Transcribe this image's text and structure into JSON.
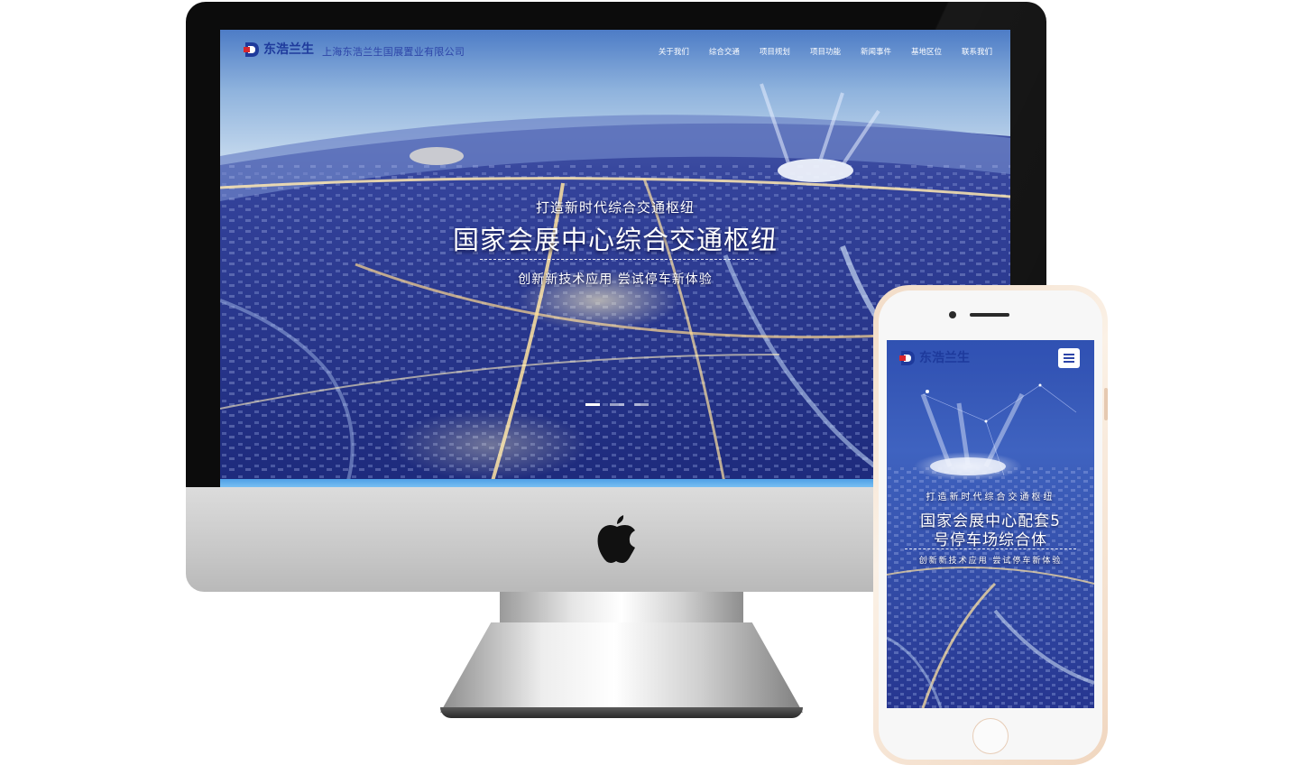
{
  "desktop": {
    "brand_name": "东浩兰生",
    "company_name": "上海东浩兰生国展置业有限公司",
    "nav": [
      "关于我们",
      "综合交通",
      "项目规划",
      "项目功能",
      "新闻事件",
      "基地区位",
      "联系我们"
    ],
    "hero": {
      "tagline": "打造新时代综合交通枢纽",
      "title": "国家会展中心综合交通枢纽",
      "subtitle": "创新新技术应用 尝试停车新体验"
    },
    "slides": {
      "count": 3,
      "active": 1
    }
  },
  "mobile": {
    "brand_name": "东浩兰生",
    "hero": {
      "tagline": "打造新时代综合交通枢纽",
      "title_line1": "国家会展中心配套5",
      "title_line2": "号停车场综合体",
      "subtitle": "创新新技术应用 尝试停车新体验"
    }
  },
  "colors": {
    "brand_blue": "#1e3a9c",
    "brand_red": "#d8262c",
    "sky_top": "#5a86c8",
    "city_night": "#1b2a80"
  }
}
